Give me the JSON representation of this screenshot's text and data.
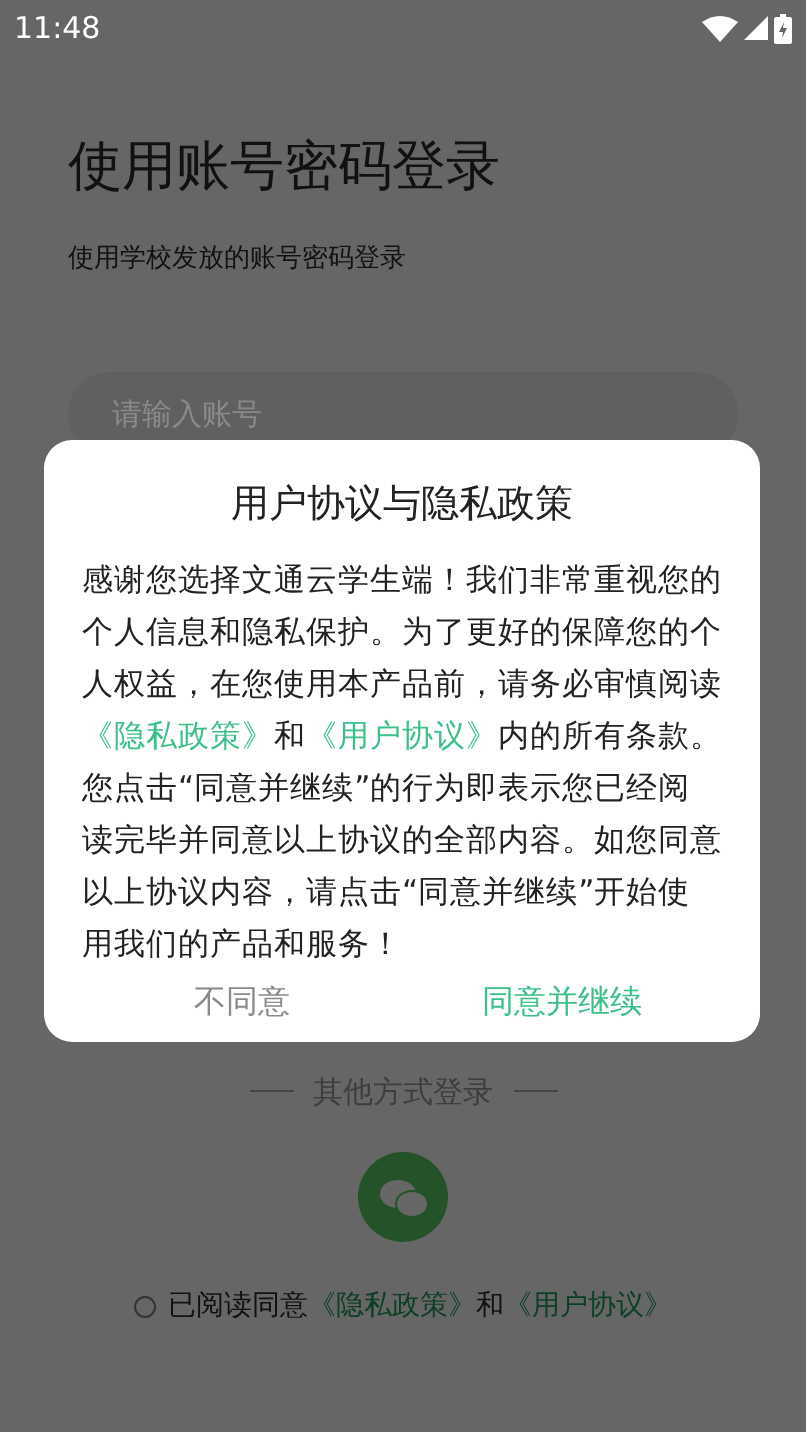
{
  "status_bar": {
    "time": "11:48"
  },
  "login": {
    "title": "使用账号密码登录",
    "subtitle": "使用学校发放的账号密码登录",
    "account_field": {
      "placeholder": "请输入账号"
    }
  },
  "other_login": {
    "label": "其他方式登录"
  },
  "agreement": {
    "checked": false,
    "prefix": "已阅读同意",
    "links": [
      "《隐私政策》",
      "《用户协议》"
    ],
    "joiner": "和"
  },
  "dialog": {
    "title": "用户协议与隐私政策",
    "intro": "感谢您选择文通云学生端！我们非常重视您的个人信息和隐私保护。为了更好的保障您的个人权益，在您使用本产品前，请务必审慎阅读",
    "links": [
      "《隐私政策》",
      "《用户协议》"
    ],
    "joiner": "和",
    "outro": "内的所有条款。您点击“同意并继续”的行为即表示您已经阅读完毕并同意以上协议的全部内容。如您同意以上协议内容，请点击“同意并继续”开始使用我们的产品和服务！",
    "buttons": [
      {
        "label": "不同意",
        "kind": "decline"
      },
      {
        "label": "同意并继续",
        "kind": "accept"
      }
    ]
  }
}
